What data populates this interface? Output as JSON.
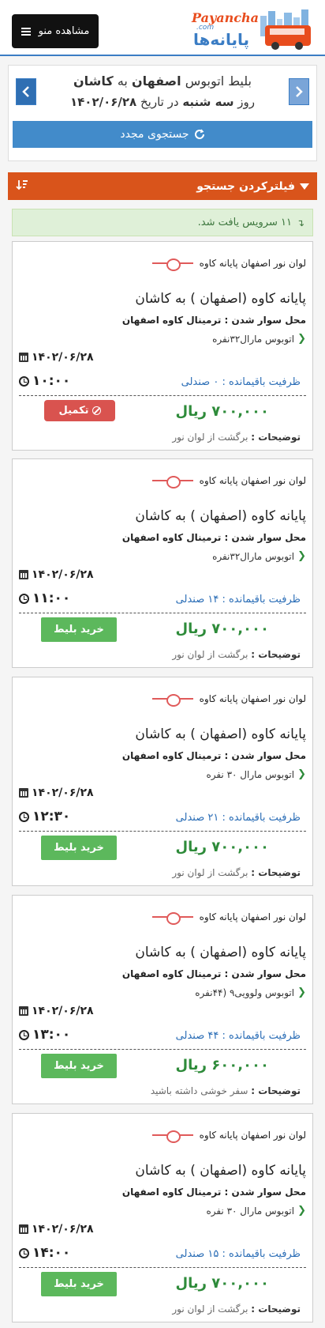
{
  "header": {
    "menu_label": "مشاهده منو",
    "logo_text_en": "Payancha",
    "logo_text_com": ".com",
    "logo_text_fa": "پایانه‌ها"
  },
  "search": {
    "title_prefix": "بلیط اتوبوس",
    "origin": "اصفهان",
    "title_mid": "به",
    "destination": "کاشان",
    "date_prefix": "روز",
    "weekday": "سه شنبه",
    "date_mid": "در تاریخ",
    "date": "۱۴۰۲/۰۶/۲۸",
    "research_label": "جستجوی مجدد"
  },
  "filter": {
    "label": "فیلترکردن جستجو"
  },
  "result": {
    "text": "۱۱ سرویس یافت شد."
  },
  "services": [
    {
      "company": "لوان نور اصفهان پایانه کاوه",
      "terminal": "پایانه کاوه (اصفهان ) به کاشان",
      "boarding": "محل سوار شدن : ترمینال کاوه اصفهان",
      "bus_type": "اتوبوس مارال۳۲نفره",
      "date": "۱۴۰۲/۰۶/۲۸",
      "time": "۱۰:۰۰",
      "capacity": "ظرفیت باقیمانده : ۰ صندلی",
      "price": "۷۰۰,۰۰۰ ریال",
      "action": "تکمیل",
      "action_type": "full",
      "desc_label": "توضیحات :",
      "desc_value": "برگشت از لوان نور"
    },
    {
      "company": "لوان نور اصفهان پایانه کاوه",
      "terminal": "پایانه کاوه (اصفهان ) به کاشان",
      "boarding": "محل سوار شدن : ترمینال کاوه اصفهان",
      "bus_type": "اتوبوس مارال۳۲نفره",
      "date": "۱۴۰۲/۰۶/۲۸",
      "time": "۱۱:۰۰",
      "capacity": "ظرفیت باقیمانده : ۱۴ صندلی",
      "price": "۷۰۰,۰۰۰ ریال",
      "action": "خرید بلیط",
      "action_type": "buy",
      "desc_label": "توضیحات :",
      "desc_value": "برگشت از لوان نور"
    },
    {
      "company": "لوان نور اصفهان پایانه کاوه",
      "terminal": "پایانه کاوه (اصفهان ) به کاشان",
      "boarding": "محل سوار شدن : ترمینال کاوه اصفهان",
      "bus_type": "اتوبوس مارال ۳۰ نفره",
      "date": "۱۴۰۲/۰۶/۲۸",
      "time": "۱۲:۳۰",
      "capacity": "ظرفیت باقیمانده : ۲۱ صندلی",
      "price": "۷۰۰,۰۰۰ ریال",
      "action": "خرید بلیط",
      "action_type": "buy",
      "desc_label": "توضیحات :",
      "desc_value": "برگشت از لوان نور"
    },
    {
      "company": "لوان نور اصفهان پایانه کاوه",
      "terminal": "پایانه کاوه (اصفهان ) به کاشان",
      "boarding": "محل سوار شدن : ترمینال کاوه اصفهان",
      "bus_type": "اتوبوس ولوویی۹ (۴۴نفره",
      "date": "۱۴۰۲/۰۶/۲۸",
      "time": "۱۳:۰۰",
      "capacity": "ظرفیت باقیمانده : ۴۴ صندلی",
      "price": "۶۰۰,۰۰۰ ریال",
      "action": "خرید بلیط",
      "action_type": "buy",
      "desc_label": "توضیحات :",
      "desc_value": "سفر خوشی داشته باشید"
    },
    {
      "company": "لوان نور اصفهان پایانه کاوه",
      "terminal": "پایانه کاوه (اصفهان ) به کاشان",
      "boarding": "محل سوار شدن : ترمینال کاوه اصفهان",
      "bus_type": "اتوبوس مارال ۳۰ نفره",
      "date": "۱۴۰۲/۰۶/۲۸",
      "time": "۱۴:۰۰",
      "capacity": "ظرفیت باقیمانده : ۱۵ صندلی",
      "price": "۷۰۰,۰۰۰ ریال",
      "action": "خرید بلیط",
      "action_type": "buy",
      "desc_label": "توضیحات :",
      "desc_value": "برگشت از لوان نور"
    }
  ],
  "colors": {
    "brand_blue": "#3b7dc4",
    "filter_orange": "#d9541b",
    "buy_green": "#5cb85c",
    "full_red": "#d9534f",
    "price_green": "#2e8b3a",
    "capacity_blue": "#2a6db6"
  },
  "icons": {
    "menu": "bars-icon",
    "nav_prev": "chevron-left-icon",
    "nav_next": "chevron-right-icon",
    "research": "refresh-icon",
    "filter": "funnel-icon",
    "sort": "sort-icon",
    "result": "pin-icon",
    "date": "calendar-icon",
    "time": "clock-icon",
    "bus_type": "chevron-left-icon",
    "full": "ban-icon"
  }
}
